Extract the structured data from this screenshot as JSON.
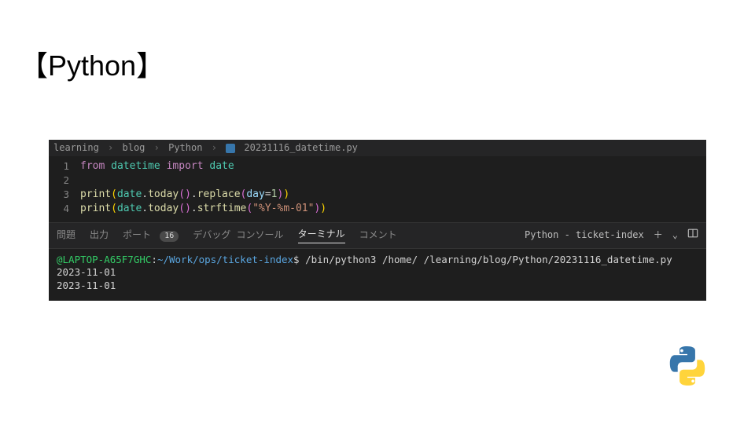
{
  "title": "【Python】",
  "breadcrumb": {
    "seg1": "learning",
    "seg2": "blog",
    "seg3": "Python",
    "file": "20231116_datetime.py"
  },
  "code": {
    "line_numbers": [
      "1",
      "2",
      "3",
      "4"
    ],
    "l1": {
      "kw_from": "from",
      "mod": "datetime",
      "kw_import": "import",
      "name": "date"
    },
    "l3": {
      "print": "print",
      "date": "date",
      "today": "today",
      "replace": "replace",
      "kw_day": "day",
      "eq": "=",
      "num": "1"
    },
    "l4": {
      "print": "print",
      "date": "date",
      "today": "today",
      "strftime": "strftime",
      "fmt": "\"%Y-%m-01\""
    }
  },
  "panel": {
    "tabs": {
      "problems": "問題",
      "output": "出力",
      "ports": "ポート",
      "ports_badge": "16",
      "debug": "デバッグ コンソール",
      "terminal": "ターミナル",
      "comments": "コメント"
    },
    "right_label": "Python - ticket-index"
  },
  "terminal": {
    "prompt_host": "@LAPTOP-A65F7GHC",
    "prompt_sep": ":",
    "prompt_path": "~/Work/ops/ticket-index",
    "prompt_dollar": "$ ",
    "cmd_part1": "/bin/python3 /home/",
    "cmd_part2": "/learning/blog/Python/20231116_datetime.py",
    "out1": "2023-11-01",
    "out2": "2023-11-01"
  }
}
